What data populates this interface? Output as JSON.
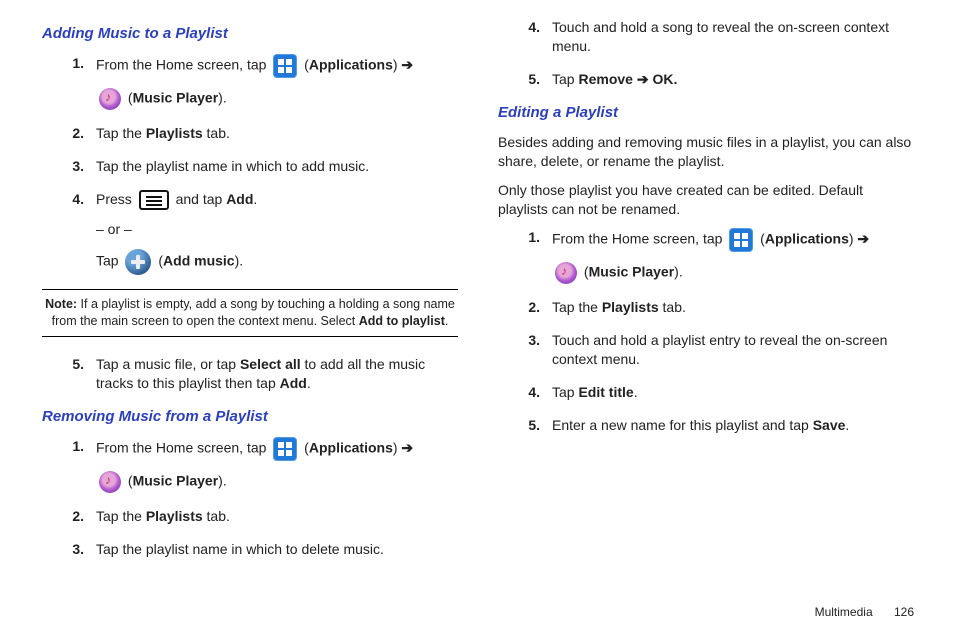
{
  "left": {
    "sec1_title": "Adding Music to a Playlist",
    "s1": {
      "n1": "1.",
      "t1a": "From the Home screen, tap ",
      "t1_apps": "Applications",
      "t1_arrow": " ➔ ",
      "t1_music": "Music Player",
      "n2": "2.",
      "t2a": "Tap the ",
      "t2b": "Playlists",
      "t2c": " tab.",
      "n3": "3.",
      "t3": "Tap the playlist name in which to add music.",
      "n4": "4.",
      "t4a": "Press ",
      "t4b": " and tap ",
      "t4c": "Add",
      "t4d": ".",
      "or": "– or –",
      "t4e": "Tap ",
      "t4f": "Add music",
      "note_label": "Note:",
      "note_body": " If a playlist is empty, add a song by touching a holding a song name from the main screen to open the context menu. Select ",
      "note_bold": "Add to playlist",
      "note_end": ".",
      "n5": "5.",
      "t5a": "Tap a music file, or tap ",
      "t5b": "Select all",
      "t5c": " to add all the music tracks to this playlist then tap ",
      "t5d": "Add",
      "t5e": "."
    },
    "sec2_title": "Removing Music from a Playlist",
    "s2": {
      "n1": "1.",
      "t1a": "From the Home screen, tap ",
      "t1_apps": "Applications",
      "t1_arrow": " ➔ ",
      "t1_music": "Music Player",
      "n2": "2.",
      "t2a": "Tap the ",
      "t2b": "Playlists",
      "t2c": " tab.",
      "n3": "3.",
      "t3": "Tap the playlist name in which to delete music."
    }
  },
  "right": {
    "s2cont": {
      "n4": "4.",
      "t4": "Touch and hold a song to reveal the on-screen context menu.",
      "n5": "5.",
      "t5a": "Tap ",
      "t5b": "Remove ➔ OK."
    },
    "sec3_title": "Editing a Playlist",
    "p1": "Besides adding and removing music files in a playlist, you can also share, delete, or rename the playlist.",
    "p2": "Only those playlist you have created can be edited. Default playlists can not be renamed.",
    "s3": {
      "n1": "1.",
      "t1a": "From the Home screen, tap ",
      "t1_apps": "Applications",
      "t1_arrow": " ➔ ",
      "t1_music": "Music Player",
      "n2": "2.",
      "t2a": "Tap the ",
      "t2b": "Playlists",
      "t2c": " tab.",
      "n3": "3.",
      "t3": "Touch and hold a playlist entry to reveal the on-screen context menu.",
      "n4": "4.",
      "t4a": "Tap ",
      "t4b": "Edit title",
      "t4c": ".",
      "n5": "5.",
      "t5a": "Enter a new name for this playlist and tap ",
      "t5b": "Save",
      "t5c": "."
    }
  },
  "footer": {
    "section": "Multimedia",
    "page": "126"
  }
}
